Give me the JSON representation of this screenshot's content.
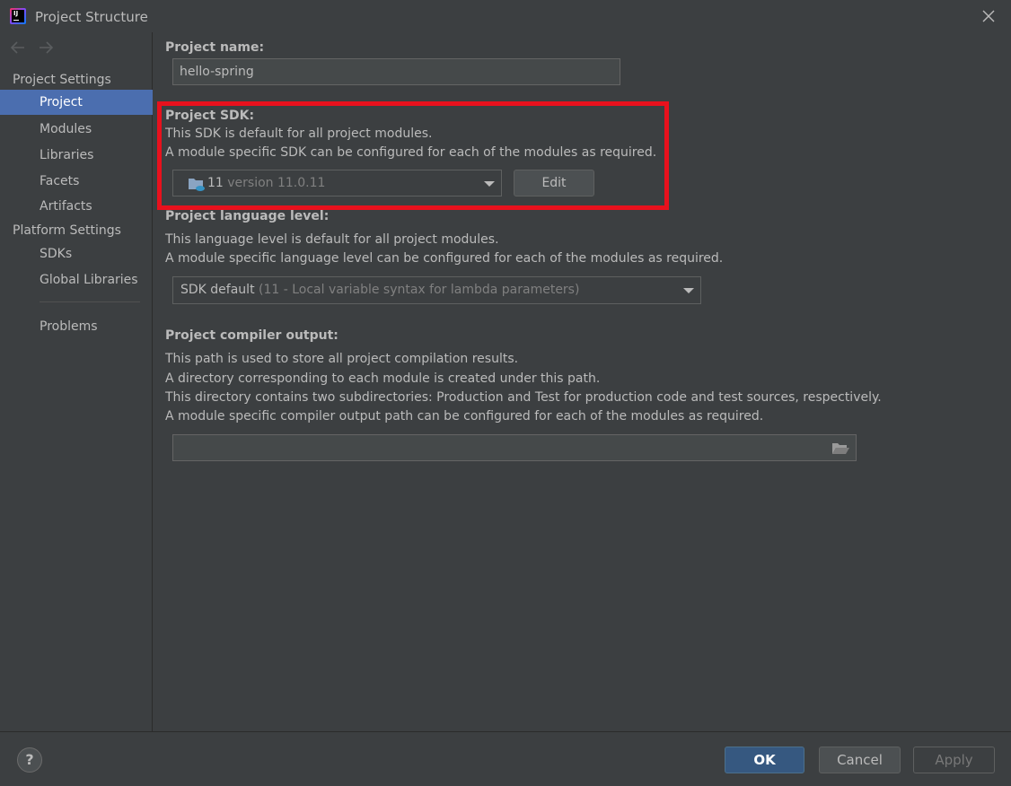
{
  "window": {
    "title": "Project Structure"
  },
  "sidebar": {
    "project_settings_label": "Project Settings",
    "platform_settings_label": "Platform Settings",
    "items": {
      "project": "Project",
      "modules": "Modules",
      "libraries": "Libraries",
      "facets": "Facets",
      "artifacts": "Artifacts",
      "sdks": "SDKs",
      "global_libraries": "Global Libraries",
      "problems": "Problems"
    },
    "selected": "Project"
  },
  "project_name": {
    "label": "Project name:",
    "value": "hello-spring"
  },
  "project_sdk": {
    "label": "Project SDK:",
    "desc_line1": "This SDK is default for all project modules.",
    "desc_line2": "A module specific SDK can be configured for each of the modules as required.",
    "selected_sdk": "11",
    "selected_sdk_version": "version 11.0.11",
    "edit_label": "Edit"
  },
  "language_level": {
    "label": "Project language level:",
    "desc_line1": "This language level is default for all project modules.",
    "desc_line2": "A module specific language level can be configured for each of the modules as required.",
    "selected": "SDK default",
    "selected_detail": "(11 - Local variable syntax for lambda parameters)"
  },
  "compiler_output": {
    "label": "Project compiler output:",
    "desc_line1": "This path is used to store all project compilation results.",
    "desc_line2": "A directory corresponding to each module is created under this path.",
    "desc_line3": "This directory contains two subdirectories: Production and Test for production code and test sources, respectively.",
    "desc_line4": "A module specific compiler output path can be configured for each of the modules as required.",
    "path_value": ""
  },
  "footer": {
    "help_label": "?",
    "ok_label": "OK",
    "cancel_label": "Cancel",
    "apply_label": "Apply"
  },
  "colors": {
    "background": "#3c3f41",
    "selection": "#4b6eaf",
    "ok_button": "#365880",
    "highlight_box": "#e8111d"
  }
}
